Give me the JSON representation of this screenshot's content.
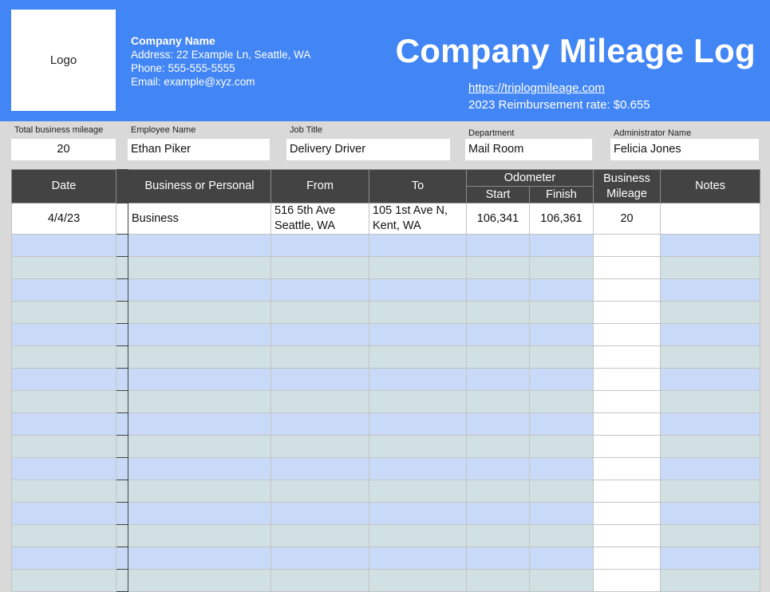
{
  "header": {
    "logo_text": "Logo",
    "company_name": "Company Name",
    "address": "Address: 22 Example Ln, Seattle, WA",
    "phone": "Phone: 555-555-5555",
    "email": "Email: example@xyz.com",
    "title": "Company Mileage Log",
    "link": "https://triplogmileage.com",
    "rate": "2023 Reimbursement rate: $0.655"
  },
  "fields": {
    "total_label": "Total business mileage",
    "total_value": "20",
    "employee_label": "Employee Name",
    "employee_value": "Ethan Piker",
    "job_label": "Job Title",
    "job_value": "Delivery Driver",
    "dept_label": "Department",
    "dept_value": "Mail Room",
    "admin_label": "Administrator Name",
    "admin_value": "Felicia Jones"
  },
  "table": {
    "headers": {
      "date": "Date",
      "type": "Business or Personal",
      "from": "From",
      "to": "To",
      "odometer": "Odometer",
      "start": "Start",
      "finish": "Finish",
      "mileage": "Business Mileage",
      "notes": "Notes"
    },
    "rows": [
      {
        "date": "4/4/23",
        "type": "Business",
        "from_line1": "516 5th Ave",
        "from_line2": "Seattle, WA",
        "to_line1": "105 1st Ave N,",
        "to_line2": "Kent, WA",
        "start": "106,341",
        "finish": "106,361",
        "mileage": "20",
        "notes": ""
      }
    ]
  },
  "colors": {
    "banner": "#4285f4",
    "header_dark": "#434343",
    "row_blue": "#c9daf8",
    "row_green": "#d0e0e3"
  }
}
